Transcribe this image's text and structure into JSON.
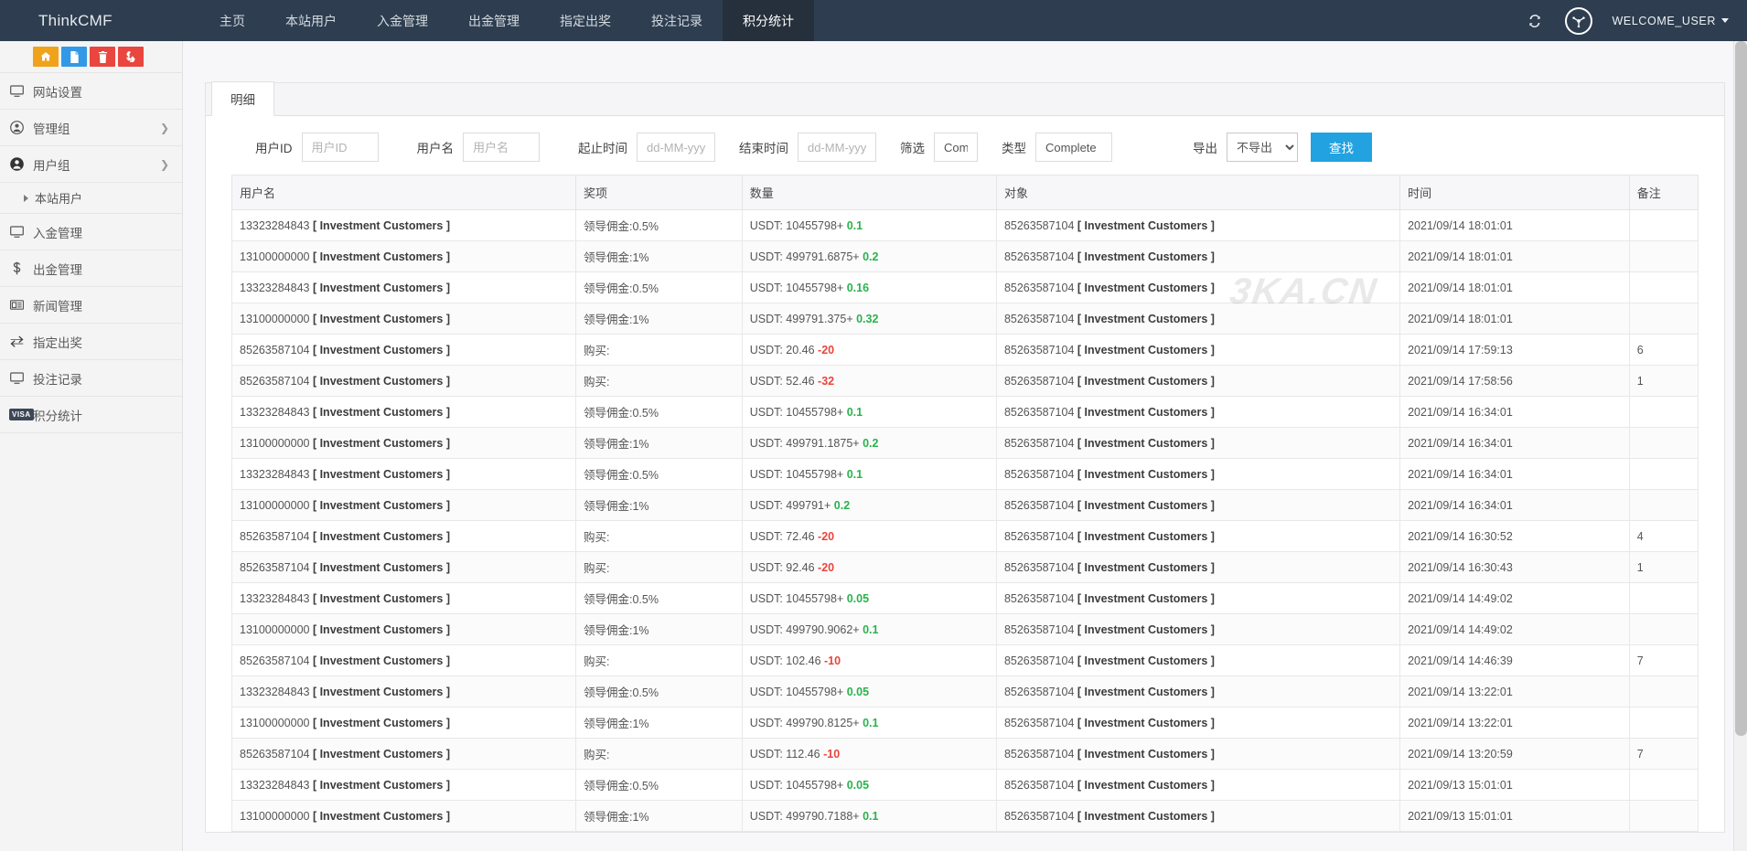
{
  "navbar": {
    "brand": "ThinkCMF",
    "items": [
      {
        "label": "主页",
        "active": false
      },
      {
        "label": "本站用户",
        "active": false
      },
      {
        "label": "入金管理",
        "active": false
      },
      {
        "label": "出金管理",
        "active": false
      },
      {
        "label": "指定出奖",
        "active": false
      },
      {
        "label": "投注记录",
        "active": false
      },
      {
        "label": "积分统计",
        "active": true
      }
    ],
    "refresh_icon": "refresh-icon",
    "globe_icon": "globe-icon",
    "user_label": "WELCOME_USER"
  },
  "sidebar": {
    "quick_actions": [
      {
        "name": "home-icon",
        "color": "#f0a21b"
      },
      {
        "name": "file-icon",
        "color": "#3399e6"
      },
      {
        "name": "trash-icon",
        "color": "#e8463e"
      },
      {
        "name": "recycle-icon",
        "color": "#e8463e"
      }
    ],
    "items": [
      {
        "label": "网站设置",
        "icon": "monitor-icon",
        "arrow": false
      },
      {
        "label": "管理组",
        "icon": "user-circle-icon",
        "arrow": true
      },
      {
        "label": "用户组",
        "icon": "user-solid-icon",
        "arrow": true
      }
    ],
    "sub_item": {
      "label": "本站用户"
    },
    "items2": [
      {
        "label": "入金管理",
        "icon": "monitor-icon",
        "arrow": false
      },
      {
        "label": "出金管理",
        "icon": "dollar-icon",
        "arrow": false
      },
      {
        "label": "新闻管理",
        "icon": "news-icon",
        "arrow": false
      },
      {
        "label": "指定出奖",
        "icon": "exchange-icon",
        "arrow": false
      },
      {
        "label": "投注记录",
        "icon": "monitor-icon",
        "arrow": false
      },
      {
        "label": "积分统计",
        "icon": "visa-icon",
        "arrow": false
      }
    ]
  },
  "panel": {
    "tab_label": "明细",
    "watermark": "3KA.CN"
  },
  "filters": {
    "userid_label": "用户ID",
    "userid_placeholder": "用户ID",
    "userid_value": "",
    "username_label": "用户名",
    "username_placeholder": "用户名",
    "username_value": "",
    "start_label": "起止时间",
    "start_placeholder": "dd-MM-yyyy",
    "start_value": "",
    "end_label": "结束时间",
    "end_placeholder": "dd-MM-yyyy",
    "end_value": "",
    "screen_label": "筛选",
    "screen_value": "Comple",
    "type_label": "类型",
    "type_value": "Complete",
    "export_label": "导出",
    "export_selected": "不导出",
    "export_options": [
      "不导出"
    ],
    "search_button": "查找"
  },
  "table": {
    "columns": [
      "用户名",
      "奖项",
      "数量",
      "对象",
      "时间",
      "备注"
    ],
    "rows": [
      {
        "user": "13323284843",
        "user_tag": "[ Investment Customers ]",
        "prize": "领导佣金:0.5%",
        "amount_prefix": "USDT: 10455798+",
        "delta": "0.1",
        "delta_sign": "pos",
        "object": "85263587104",
        "object_tag": "[ Investment Customers ]",
        "time": "2021/09/14 18:01:01",
        "remark": ""
      },
      {
        "user": "13100000000",
        "user_tag": "[ Investment Customers ]",
        "prize": "领导佣金:1%",
        "amount_prefix": "USDT: 499791.6875+",
        "delta": "0.2",
        "delta_sign": "pos",
        "object": "85263587104",
        "object_tag": "[ Investment Customers ]",
        "time": "2021/09/14 18:01:01",
        "remark": ""
      },
      {
        "user": "13323284843",
        "user_tag": "[ Investment Customers ]",
        "prize": "领导佣金:0.5%",
        "amount_prefix": "USDT: 10455798+",
        "delta": "0.16",
        "delta_sign": "pos",
        "object": "85263587104",
        "object_tag": "[ Investment Customers ]",
        "time": "2021/09/14 18:01:01",
        "remark": ""
      },
      {
        "user": "13100000000",
        "user_tag": "[ Investment Customers ]",
        "prize": "领导佣金:1%",
        "amount_prefix": "USDT: 499791.375+",
        "delta": "0.32",
        "delta_sign": "pos",
        "object": "85263587104",
        "object_tag": "[ Investment Customers ]",
        "time": "2021/09/14 18:01:01",
        "remark": ""
      },
      {
        "user": "85263587104",
        "user_tag": "[ Investment Customers ]",
        "prize": "购买:",
        "amount_prefix": "USDT: 20.46",
        "delta": "-20",
        "delta_sign": "neg",
        "object": "85263587104",
        "object_tag": "[ Investment Customers ]",
        "time": "2021/09/14 17:59:13",
        "remark": "6"
      },
      {
        "user": "85263587104",
        "user_tag": "[ Investment Customers ]",
        "prize": "购买:",
        "amount_prefix": "USDT: 52.46",
        "delta": "-32",
        "delta_sign": "neg",
        "object": "85263587104",
        "object_tag": "[ Investment Customers ]",
        "time": "2021/09/14 17:58:56",
        "remark": "1"
      },
      {
        "user": "13323284843",
        "user_tag": "[ Investment Customers ]",
        "prize": "领导佣金:0.5%",
        "amount_prefix": "USDT: 10455798+",
        "delta": "0.1",
        "delta_sign": "pos",
        "object": "85263587104",
        "object_tag": "[ Investment Customers ]",
        "time": "2021/09/14 16:34:01",
        "remark": ""
      },
      {
        "user": "13100000000",
        "user_tag": "[ Investment Customers ]",
        "prize": "领导佣金:1%",
        "amount_prefix": "USDT: 499791.1875+",
        "delta": "0.2",
        "delta_sign": "pos",
        "object": "85263587104",
        "object_tag": "[ Investment Customers ]",
        "time": "2021/09/14 16:34:01",
        "remark": ""
      },
      {
        "user": "13323284843",
        "user_tag": "[ Investment Customers ]",
        "prize": "领导佣金:0.5%",
        "amount_prefix": "USDT: 10455798+",
        "delta": "0.1",
        "delta_sign": "pos",
        "object": "85263587104",
        "object_tag": "[ Investment Customers ]",
        "time": "2021/09/14 16:34:01",
        "remark": ""
      },
      {
        "user": "13100000000",
        "user_tag": "[ Investment Customers ]",
        "prize": "领导佣金:1%",
        "amount_prefix": "USDT: 499791+",
        "delta": "0.2",
        "delta_sign": "pos",
        "object": "85263587104",
        "object_tag": "[ Investment Customers ]",
        "time": "2021/09/14 16:34:01",
        "remark": ""
      },
      {
        "user": "85263587104",
        "user_tag": "[ Investment Customers ]",
        "prize": "购买:",
        "amount_prefix": "USDT: 72.46",
        "delta": "-20",
        "delta_sign": "neg",
        "object": "85263587104",
        "object_tag": "[ Investment Customers ]",
        "time": "2021/09/14 16:30:52",
        "remark": "4"
      },
      {
        "user": "85263587104",
        "user_tag": "[ Investment Customers ]",
        "prize": "购买:",
        "amount_prefix": "USDT: 92.46",
        "delta": "-20",
        "delta_sign": "neg",
        "object": "85263587104",
        "object_tag": "[ Investment Customers ]",
        "time": "2021/09/14 16:30:43",
        "remark": "1"
      },
      {
        "user": "13323284843",
        "user_tag": "[ Investment Customers ]",
        "prize": "领导佣金:0.5%",
        "amount_prefix": "USDT: 10455798+",
        "delta": "0.05",
        "delta_sign": "pos",
        "object": "85263587104",
        "object_tag": "[ Investment Customers ]",
        "time": "2021/09/14 14:49:02",
        "remark": ""
      },
      {
        "user": "13100000000",
        "user_tag": "[ Investment Customers ]",
        "prize": "领导佣金:1%",
        "amount_prefix": "USDT: 499790.9062+",
        "delta": "0.1",
        "delta_sign": "pos",
        "object": "85263587104",
        "object_tag": "[ Investment Customers ]",
        "time": "2021/09/14 14:49:02",
        "remark": ""
      },
      {
        "user": "85263587104",
        "user_tag": "[ Investment Customers ]",
        "prize": "购买:",
        "amount_prefix": "USDT: 102.46",
        "delta": "-10",
        "delta_sign": "neg",
        "object": "85263587104",
        "object_tag": "[ Investment Customers ]",
        "time": "2021/09/14 14:46:39",
        "remark": "7"
      },
      {
        "user": "13323284843",
        "user_tag": "[ Investment Customers ]",
        "prize": "领导佣金:0.5%",
        "amount_prefix": "USDT: 10455798+",
        "delta": "0.05",
        "delta_sign": "pos",
        "object": "85263587104",
        "object_tag": "[ Investment Customers ]",
        "time": "2021/09/14 13:22:01",
        "remark": ""
      },
      {
        "user": "13100000000",
        "user_tag": "[ Investment Customers ]",
        "prize": "领导佣金:1%",
        "amount_prefix": "USDT: 499790.8125+",
        "delta": "0.1",
        "delta_sign": "pos",
        "object": "85263587104",
        "object_tag": "[ Investment Customers ]",
        "time": "2021/09/14 13:22:01",
        "remark": ""
      },
      {
        "user": "85263587104",
        "user_tag": "[ Investment Customers ]",
        "prize": "购买:",
        "amount_prefix": "USDT: 112.46",
        "delta": "-10",
        "delta_sign": "neg",
        "object": "85263587104",
        "object_tag": "[ Investment Customers ]",
        "time": "2021/09/14 13:20:59",
        "remark": "7"
      },
      {
        "user": "13323284843",
        "user_tag": "[ Investment Customers ]",
        "prize": "领导佣金:0.5%",
        "amount_prefix": "USDT: 10455798+",
        "delta": "0.05",
        "delta_sign": "pos",
        "object": "85263587104",
        "object_tag": "[ Investment Customers ]",
        "time": "2021/09/13 15:01:01",
        "remark": ""
      },
      {
        "user": "13100000000",
        "user_tag": "[ Investment Customers ]",
        "prize": "领导佣金:1%",
        "amount_prefix": "USDT: 499790.7188+",
        "delta": "0.1",
        "delta_sign": "pos",
        "object": "85263587104",
        "object_tag": "[ Investment Customers ]",
        "time": "2021/09/13 15:01:01",
        "remark": ""
      }
    ]
  },
  "colors": {
    "navbar_bg": "#2e3e50",
    "accent": "#22a2e0",
    "positive": "#2bb24c",
    "negative": "#e8453c"
  }
}
